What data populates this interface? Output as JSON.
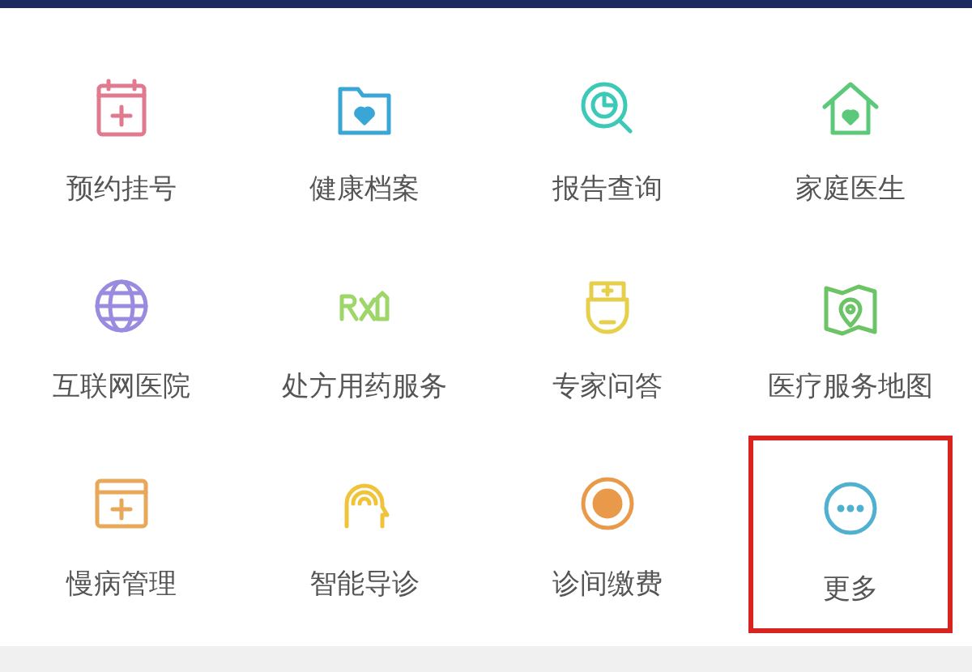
{
  "services": [
    {
      "label": "预约挂号",
      "color": "#e07a8f",
      "highlighted": false
    },
    {
      "label": "健康档案",
      "color": "#3aa6d6",
      "highlighted": false
    },
    {
      "label": "报告查询",
      "color": "#3cc9b8",
      "highlighted": false
    },
    {
      "label": "家庭医生",
      "color": "#5cc97a",
      "highlighted": false
    },
    {
      "label": "互联网医院",
      "color": "#9a8ae0",
      "highlighted": false
    },
    {
      "label": "处方用药服务",
      "color": "#9ed66a",
      "highlighted": false
    },
    {
      "label": "专家问答",
      "color": "#e6cf4a",
      "highlighted": false
    },
    {
      "label": "医疗服务地图",
      "color": "#6cc466",
      "highlighted": false
    },
    {
      "label": "慢病管理",
      "color": "#e8a85a",
      "highlighted": false
    },
    {
      "label": "智能导诊",
      "color": "#f0c43a",
      "highlighted": false
    },
    {
      "label": "诊间缴费",
      "color": "#e89a4a",
      "highlighted": false
    },
    {
      "label": "更多",
      "color": "#4fb0cf",
      "highlighted": true
    }
  ]
}
